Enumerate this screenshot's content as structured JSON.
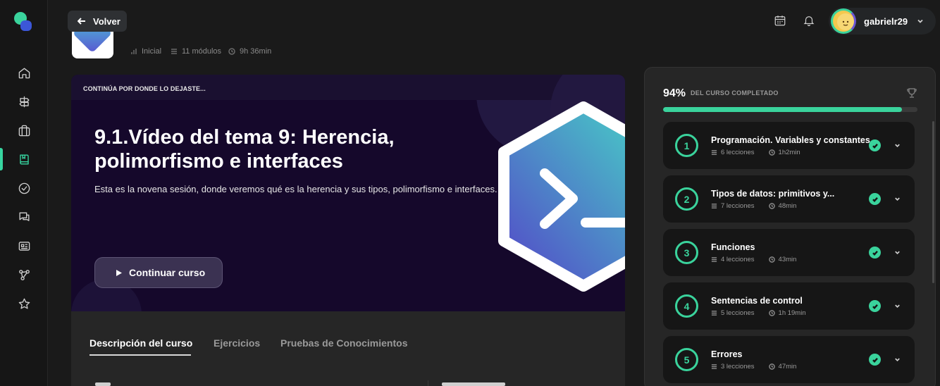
{
  "topbar": {
    "back_label": "Volver",
    "username": "gabrielr29"
  },
  "course": {
    "level": "Inicial",
    "modules": "11 módulos",
    "duration": "9h 36min"
  },
  "hero": {
    "label": "CONTINÚA POR DONDE LO DEJASTE...",
    "title": "9.1.Vídeo del tema 9: Herencia, polimorfismo e interfaces",
    "description": "Esta es la novena sesión, donde veremos qué es la herencia y sus tipos, polimorfismo e interfaces.",
    "button": "Continuar curso"
  },
  "tabs": [
    {
      "label": "Descripción del curso",
      "active": true
    },
    {
      "label": "Ejercicios",
      "active": false
    },
    {
      "label": "Pruebas de Conocimientos",
      "active": false
    }
  ],
  "progress": {
    "percent": "94%",
    "percent_value": 0.94,
    "label": "DEL CURSO COMPLETADO",
    "accent": "#3ad39c"
  },
  "modules": [
    {
      "number": "1",
      "title": "Programación. Variables y constantes",
      "lessons": "6 lecciones",
      "duration": "1h2min",
      "completed": true
    },
    {
      "number": "2",
      "title": "Tipos de datos: primitivos y...",
      "lessons": "7 lecciones",
      "duration": "48min",
      "completed": true
    },
    {
      "number": "3",
      "title": "Funciones",
      "lessons": "4 lecciones",
      "duration": "43min",
      "completed": true
    },
    {
      "number": "4",
      "title": "Sentencias de control",
      "lessons": "5 lecciones",
      "duration": "1h 19min",
      "completed": true
    },
    {
      "number": "5",
      "title": "Errores",
      "lessons": "3 lecciones",
      "duration": "47min",
      "completed": true
    }
  ]
}
